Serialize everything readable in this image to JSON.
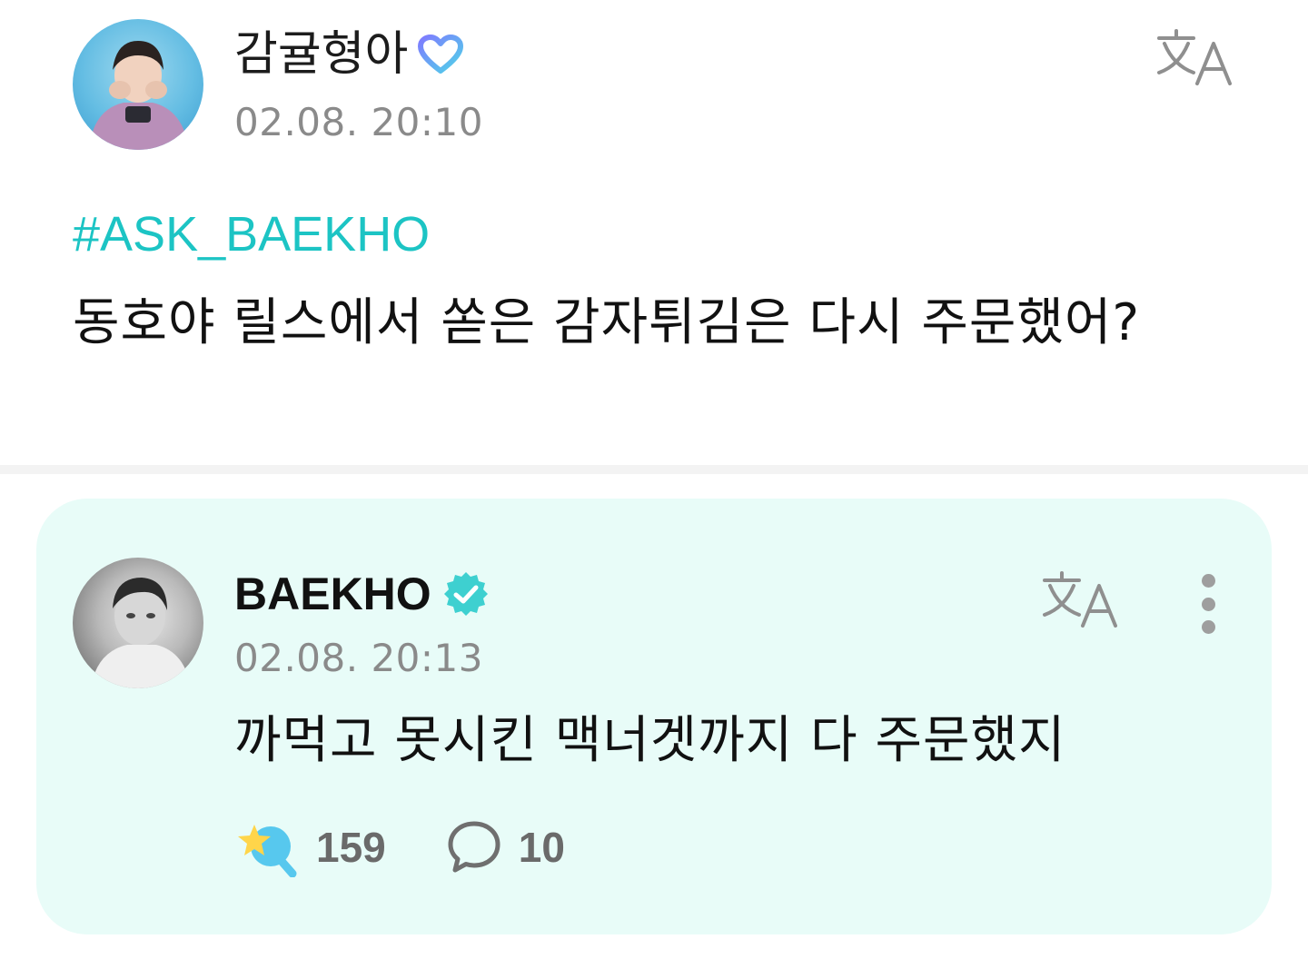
{
  "fan_post": {
    "username": "감귤형아",
    "timestamp": "02.08. 20:10",
    "hashtag": "#ASK_BAEKHO",
    "body": "동호야 릴스에서 쏟은 감자튀김은 다시 주문했어?",
    "badge_icon": "membership-heart-icon",
    "translate_icon": "translate-icon"
  },
  "artist_reply": {
    "username": "BAEKHO",
    "timestamp": "02.08. 20:13",
    "body": "까먹고 못시킨 맥너겟까지 다 주문했지",
    "badge_icon": "verified-check-icon",
    "translate_icon": "translate-icon",
    "more_icon": "more-vertical-icon",
    "reactions": {
      "like_icon": "star-wand-icon",
      "like_count": "159",
      "comment_icon": "comment-bubble-icon",
      "comment_count": "10"
    }
  },
  "colors": {
    "hashtag": "#1cc4c4",
    "reply_card_bg": "#e8fcf8",
    "verified_badge": "#3ed0d0",
    "timestamp": "#8a8a8a"
  }
}
